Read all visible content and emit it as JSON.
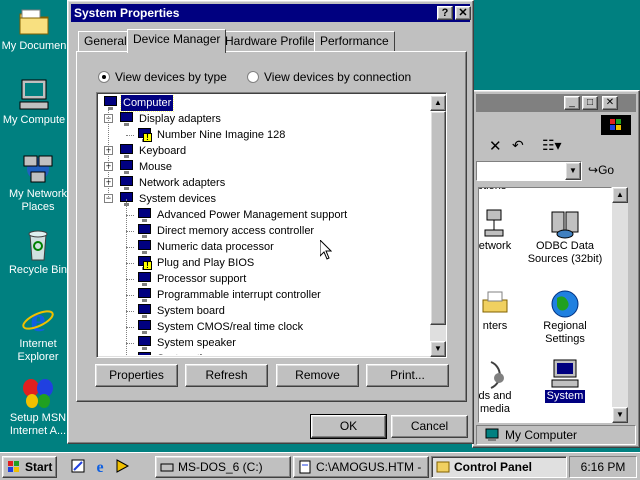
{
  "desktop": {
    "icons": [
      {
        "label": "My Documen",
        "icon": "folder-icon"
      },
      {
        "label": "My Compute",
        "icon": "computer-icon"
      },
      {
        "label_line1": "My Network",
        "label_line2": "Places",
        "icon": "network-icon"
      },
      {
        "label": "Recycle Bin",
        "icon": "recycle-bin-icon"
      },
      {
        "label_line1": "Internet",
        "label_line2": "Explorer",
        "icon": "internet-explorer-icon"
      },
      {
        "label_line1": "Setup MSN",
        "label_line2": "Internet A...",
        "icon": "msn-butterfly-icon"
      }
    ]
  },
  "dialog": {
    "title": "System Properties",
    "help_btn": "?",
    "close_btn": "✕",
    "tabs": [
      "General",
      "Device Manager",
      "Hardware Profiles",
      "Performance"
    ],
    "active_tab": "Device Manager",
    "radio_type": "View devices by type",
    "radio_connection": "View devices by connection",
    "radio_selected": "type",
    "tree": [
      {
        "label": "Computer",
        "level": 0,
        "selected": true
      },
      {
        "label": "Display adapters",
        "level": 1,
        "expander": "−"
      },
      {
        "label": "Number Nine Imagine 128",
        "level": 2,
        "warning": true
      },
      {
        "label": "Keyboard",
        "level": 1,
        "expander": "+"
      },
      {
        "label": "Mouse",
        "level": 1,
        "expander": "+"
      },
      {
        "label": "Network adapters",
        "level": 1,
        "expander": "+"
      },
      {
        "label": "System devices",
        "level": 1,
        "expander": "−"
      },
      {
        "label": "Advanced Power Management support",
        "level": 2
      },
      {
        "label": "Direct memory access controller",
        "level": 2
      },
      {
        "label": "Numeric data processor",
        "level": 2
      },
      {
        "label": "Plug and Play BIOS",
        "level": 2,
        "warning": true
      },
      {
        "label": "Processor support",
        "level": 2
      },
      {
        "label": "Programmable interrupt controller",
        "level": 2
      },
      {
        "label": "System board",
        "level": 2
      },
      {
        "label": "System CMOS/real time clock",
        "level": 2
      },
      {
        "label": "System speaker",
        "level": 2
      },
      {
        "label": "System timer",
        "level": 2
      }
    ],
    "buttons": {
      "properties": "Properties",
      "refresh": "Refresh",
      "remove": "Remove",
      "print": "Print...",
      "ok": "OK",
      "cancel": "Cancel"
    }
  },
  "control_panel": {
    "address_go": "Go",
    "items": [
      {
        "label": "etwork",
        "icon": "network-icon"
      },
      {
        "label_line1": "ODBC Data",
        "label_line2": "Sources (32bit)",
        "icon": "odbc-icon"
      },
      {
        "label": "nters",
        "icon": "printer-icon"
      },
      {
        "label_line1": "Regional",
        "label_line2": "Settings",
        "icon": "globe-icon"
      },
      {
        "label_line1": "ds and",
        "label_line2": "media",
        "icon": "sounds-icon"
      },
      {
        "label": "System",
        "icon": "system-icon"
      }
    ],
    "partial_top_label": "ptions",
    "status": "My Computer"
  },
  "taskbar": {
    "start": "Start",
    "tasks": [
      "MS-DOS_6 (C:)",
      "C:\\AMOGUS.HTM -",
      "Control Panel"
    ],
    "active_task": "Control Panel",
    "clock": "6:16 PM"
  }
}
